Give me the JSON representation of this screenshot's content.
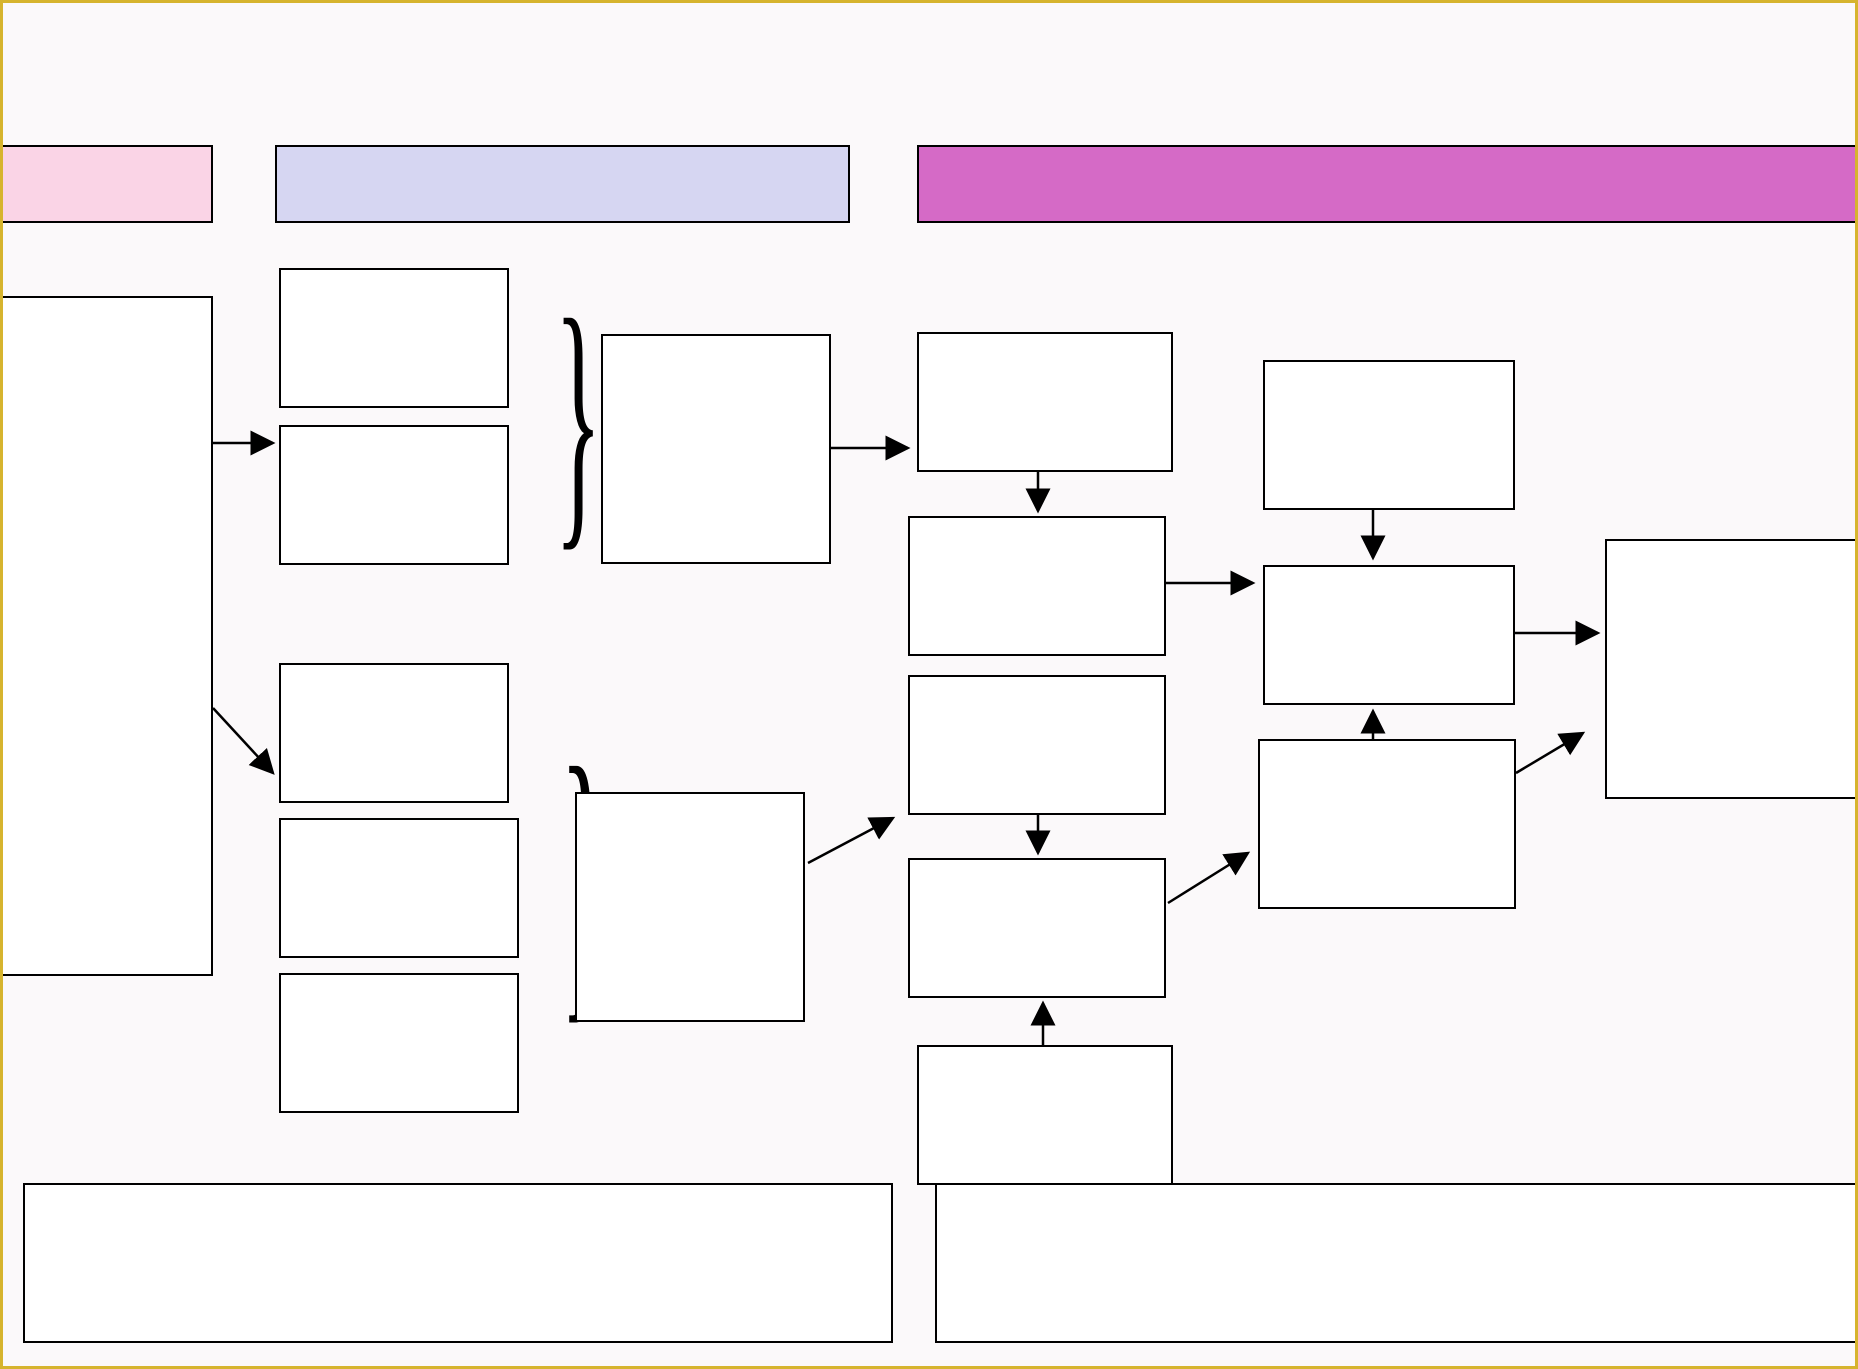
{
  "colors": {
    "canvas_border": "#d6b42e",
    "canvas_bg": "#fbf9fa",
    "header_pink_bg": "#fad4e6",
    "header_lavender_bg": "#d6d6f2",
    "header_magenta_bg": "#d56ac6",
    "box_bg": "#ffffff",
    "box_border": "#000000"
  },
  "headers": {
    "pink_label": "",
    "lavender_label": "",
    "magenta_label": ""
  },
  "boxes": {
    "left_tall": "",
    "col2_a": "",
    "col2_b": "",
    "col2_c": "",
    "col2_d": "",
    "col2_e": "",
    "col3_top": "",
    "col3_bottom": "",
    "col4_a": "",
    "col4_b": "",
    "col4_c": "",
    "col4_d": "",
    "col4_e": "",
    "col5_a": "",
    "col5_b": "",
    "col5_c": "",
    "right_big": "",
    "footer_left": "",
    "footer_right": ""
  }
}
